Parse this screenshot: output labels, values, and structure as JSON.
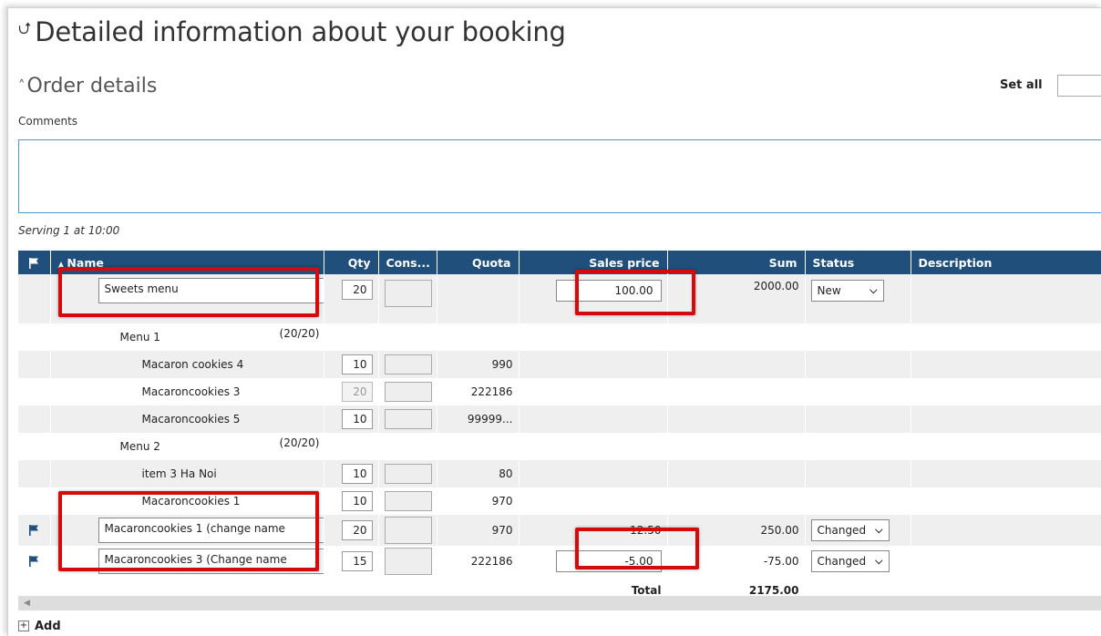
{
  "page": {
    "title": "Detailed information about your booking",
    "title_icon": "double-chevron-up-icon"
  },
  "section": {
    "title": "Order details",
    "icon": "chevron-up-icon",
    "set_all_label": "Set all"
  },
  "comments": {
    "label": "Comments",
    "value": ""
  },
  "serving": {
    "text": "Serving 1 at 10:00"
  },
  "table": {
    "headers": {
      "name": "Name",
      "qty": "Qty",
      "cons": "Cons...",
      "quota": "Quota",
      "sales_price": "Sales price",
      "sum": "Sum",
      "status": "Status",
      "description": "Description"
    },
    "rows": [
      {
        "name": "Sweets menu",
        "qty": "20",
        "quota": "",
        "price": "100.00",
        "sum": "2000.00",
        "status": "New"
      },
      {
        "name": "Menu 1",
        "count": "(20/20)"
      },
      {
        "name": "Macaron cookies 4",
        "qty": "10",
        "quota": "990"
      },
      {
        "name": "Macaroncookies 3",
        "qty": "20",
        "quota": "222186"
      },
      {
        "name": "Macaroncookies 5",
        "qty": "10",
        "quota": "99999..."
      },
      {
        "name": "Menu 2",
        "count": "(20/20)"
      },
      {
        "name": "item 3 Ha Noi",
        "qty": "10",
        "quota": "80"
      },
      {
        "name": "Macaroncookies 1",
        "qty": "10",
        "quota": "970"
      },
      {
        "name": "Macaroncookies 1 (change name",
        "qty": "20",
        "quota": "970",
        "price": "12.50",
        "sum": "250.00",
        "status": "Changed"
      },
      {
        "name": "Macaroncookies 3 (Change name",
        "qty": "15",
        "quota": "222186",
        "price": "-5.00",
        "sum": "-75.00",
        "status": "Changed"
      }
    ],
    "total": {
      "label": "Total",
      "value": "2175.00"
    }
  },
  "footer": {
    "add_label": "Add"
  },
  "colors": {
    "header_bg": "#1f4f7a",
    "highlight": "#d50a0a",
    "row_alt": "#efefef"
  }
}
